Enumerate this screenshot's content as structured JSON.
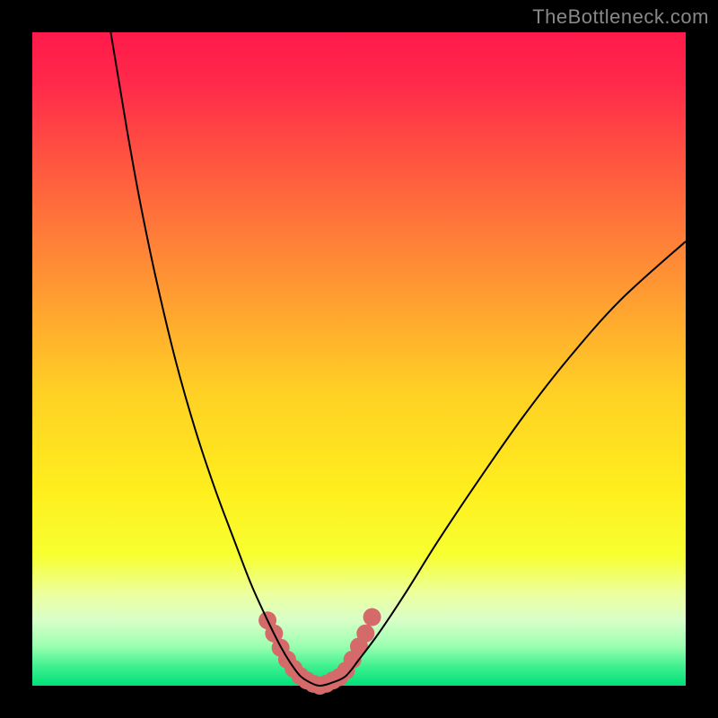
{
  "watermark": "TheBottleneck.com",
  "chart_data": {
    "type": "line",
    "title": "",
    "xlabel": "",
    "ylabel": "",
    "xlim": [
      0,
      100
    ],
    "ylim": [
      0,
      100
    ],
    "grid": false,
    "background_gradient": {
      "stops": [
        {
          "offset": 0.0,
          "color": "#ff1a4b"
        },
        {
          "offset": 0.08,
          "color": "#ff2a4a"
        },
        {
          "offset": 0.2,
          "color": "#ff5640"
        },
        {
          "offset": 0.35,
          "color": "#ff8a36"
        },
        {
          "offset": 0.55,
          "color": "#ffd024"
        },
        {
          "offset": 0.7,
          "color": "#ffee1e"
        },
        {
          "offset": 0.8,
          "color": "#f7ff30"
        },
        {
          "offset": 0.86,
          "color": "#ecffa0"
        },
        {
          "offset": 0.9,
          "color": "#d8ffc8"
        },
        {
          "offset": 0.94,
          "color": "#9affb0"
        },
        {
          "offset": 0.97,
          "color": "#40f090"
        },
        {
          "offset": 1.0,
          "color": "#00e07a"
        }
      ]
    },
    "series": [
      {
        "name": "bottleneck-curve",
        "stroke": "#000000",
        "stroke_width": 2,
        "points": [
          {
            "x": 12.0,
            "y": 100.0
          },
          {
            "x": 13.0,
            "y": 94.0
          },
          {
            "x": 14.5,
            "y": 85.0
          },
          {
            "x": 16.5,
            "y": 74.0
          },
          {
            "x": 19.0,
            "y": 62.0
          },
          {
            "x": 22.0,
            "y": 49.5
          },
          {
            "x": 25.0,
            "y": 39.0
          },
          {
            "x": 28.0,
            "y": 30.0
          },
          {
            "x": 31.0,
            "y": 22.0
          },
          {
            "x": 33.5,
            "y": 15.5
          },
          {
            "x": 36.0,
            "y": 10.0
          },
          {
            "x": 38.0,
            "y": 6.0
          },
          {
            "x": 39.5,
            "y": 3.5
          },
          {
            "x": 41.0,
            "y": 1.5
          },
          {
            "x": 42.5,
            "y": 0.5
          },
          {
            "x": 44.0,
            "y": 0.0
          },
          {
            "x": 46.0,
            "y": 0.5
          },
          {
            "x": 48.0,
            "y": 1.5
          },
          {
            "x": 50.0,
            "y": 4.0
          },
          {
            "x": 53.0,
            "y": 8.0
          },
          {
            "x": 57.0,
            "y": 14.0
          },
          {
            "x": 62.0,
            "y": 22.0
          },
          {
            "x": 68.0,
            "y": 31.0
          },
          {
            "x": 75.0,
            "y": 41.0
          },
          {
            "x": 82.0,
            "y": 50.0
          },
          {
            "x": 90.0,
            "y": 59.0
          },
          {
            "x": 100.0,
            "y": 68.0
          }
        ]
      }
    ],
    "highlight_dots": {
      "name": "bottom-dots",
      "color": "#d46a6a",
      "radius_px": 10,
      "points": [
        {
          "x": 36.0,
          "y": 10.0
        },
        {
          "x": 37.0,
          "y": 8.0
        },
        {
          "x": 38.0,
          "y": 5.8
        },
        {
          "x": 39.0,
          "y": 4.0
        },
        {
          "x": 40.0,
          "y": 2.6
        },
        {
          "x": 41.0,
          "y": 1.5
        },
        {
          "x": 42.0,
          "y": 0.8
        },
        {
          "x": 43.0,
          "y": 0.3
        },
        {
          "x": 44.0,
          "y": 0.0
        },
        {
          "x": 45.0,
          "y": 0.3
        },
        {
          "x": 46.0,
          "y": 0.8
        },
        {
          "x": 47.0,
          "y": 1.3
        },
        {
          "x": 48.0,
          "y": 2.3
        },
        {
          "x": 49.0,
          "y": 4.0
        },
        {
          "x": 50.0,
          "y": 6.0
        },
        {
          "x": 51.0,
          "y": 8.0
        },
        {
          "x": 52.0,
          "y": 10.5
        }
      ]
    }
  }
}
